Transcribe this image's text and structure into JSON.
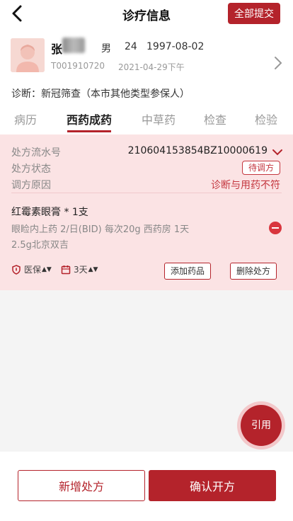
{
  "header": {
    "title": "诊疗信息",
    "submit_all": "全部提交"
  },
  "patient": {
    "name": "张",
    "gender": "男",
    "age": "24",
    "birth": "1997-08-02",
    "id": "T001910720",
    "visit_time": "2021-04-29下午"
  },
  "diagnosis": "诊断：新冠筛查（本市其他类型参保人）",
  "tabs": [
    "病历",
    "西药成药",
    "中草药",
    "检查",
    "检验"
  ],
  "prescription": {
    "serial_label": "处方流水号",
    "serial_value": "210604153854BZ10000619",
    "status_label": "处方状态",
    "status_value": "待调方",
    "reason_label": "调方原因",
    "reason_value": "诊断与用药不符",
    "drug": {
      "name": "红霉素眼膏 * 1支",
      "detail1": "眼睑内上药 2/日(BID) 每次20g 西药房 1天",
      "detail2": "2.5g北京双吉"
    },
    "insurance": "医保",
    "days": "3天",
    "add_drug": "添加药品",
    "delete_rx": "删除处方"
  },
  "quote_btn": "引用",
  "bottom": {
    "new_rx": "新增处方",
    "confirm_rx": "确认开方"
  },
  "colors": {
    "brand": "#b4232b",
    "card_bg": "#fbe3e4"
  }
}
